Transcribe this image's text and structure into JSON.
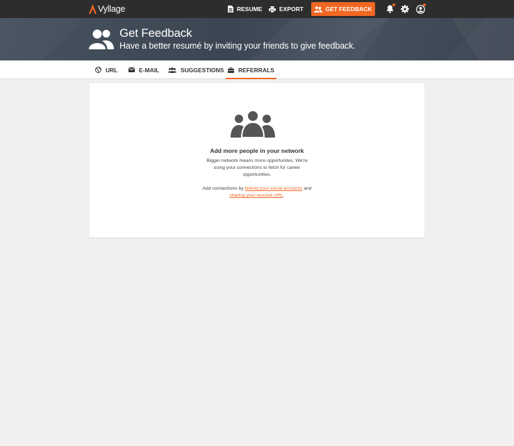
{
  "app": {
    "name": "Vyllage"
  },
  "topnav": {
    "resume_label": "RESUME",
    "export_label": "EXPORT",
    "feedback_label": "GET FEEDBACK"
  },
  "header": {
    "title": "Get Feedback",
    "subtitle": "Have a better resumé by inviting your friends to give feedback."
  },
  "tabs": [
    {
      "label": "URL",
      "icon": "globe-icon"
    },
    {
      "label": "E-MAIL",
      "icon": "envelope-icon"
    },
    {
      "label": "SUGGESTIONS",
      "icon": "people-icon"
    },
    {
      "label": "REFERRALS",
      "icon": "briefcase-icon",
      "active": true
    }
  ],
  "referrals": {
    "title": "Add more people in your network",
    "description": "Bigger network means more opportunites. We're using your connections to fetch for career opportunities.",
    "cta_prefix": "Add connections by ",
    "cta_link1": "linking your social accounts",
    "cta_middle": " and ",
    "cta_link2": "sharing your resumé URL",
    "cta_suffix": "."
  },
  "colors": {
    "accent": "#f26722",
    "topbar": "#2d2d2d",
    "banner": "#424c58",
    "page_bg": "#f0f0f0"
  }
}
